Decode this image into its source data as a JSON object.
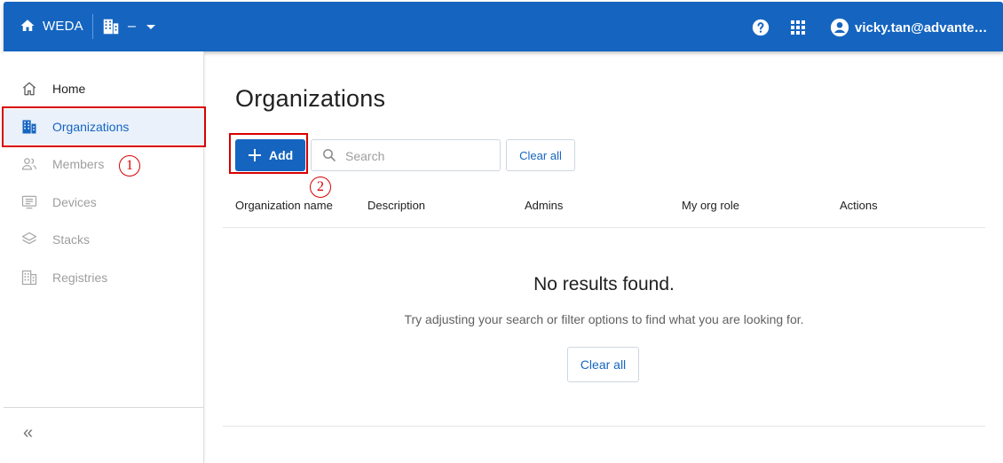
{
  "topbar": {
    "brand": "WEDA",
    "org_selector_value": "–",
    "user_email": "vicky.tan@advantec…",
    "icons": {
      "home": "home-icon",
      "org": "building-icon",
      "help": "help-circle-icon",
      "apps": "apps-grid-icon",
      "user": "account-circle-icon"
    }
  },
  "sidebar": {
    "items": [
      {
        "label": "Home",
        "icon": "home-outline-icon",
        "state": "normal"
      },
      {
        "label": "Organizations",
        "icon": "building-icon",
        "state": "active"
      },
      {
        "label": "Members",
        "icon": "members-icon",
        "state": "disabled"
      },
      {
        "label": "Devices",
        "icon": "device-icon",
        "state": "disabled"
      },
      {
        "label": "Stacks",
        "icon": "layers-icon",
        "state": "disabled"
      },
      {
        "label": "Registries",
        "icon": "registry-building-icon",
        "state": "disabled"
      }
    ],
    "collapse_label": "«"
  },
  "annotations": {
    "one": "1",
    "two": "2"
  },
  "main": {
    "title": "Organizations",
    "add_label": "Add",
    "search_placeholder": "Search",
    "clear_all_label": "Clear all",
    "columns": [
      "Organization name",
      "Description",
      "Admins",
      "My org role",
      "Actions"
    ],
    "empty_title": "No results found.",
    "empty_subtitle": "Try adjusting your search or filter options to find what you are looking for.",
    "empty_clear_label": "Clear all"
  },
  "colors": {
    "primary": "#1565c0",
    "active_bg": "#eaf1fb",
    "annotation": "#d90000",
    "disabled": "#9e9e9e"
  }
}
